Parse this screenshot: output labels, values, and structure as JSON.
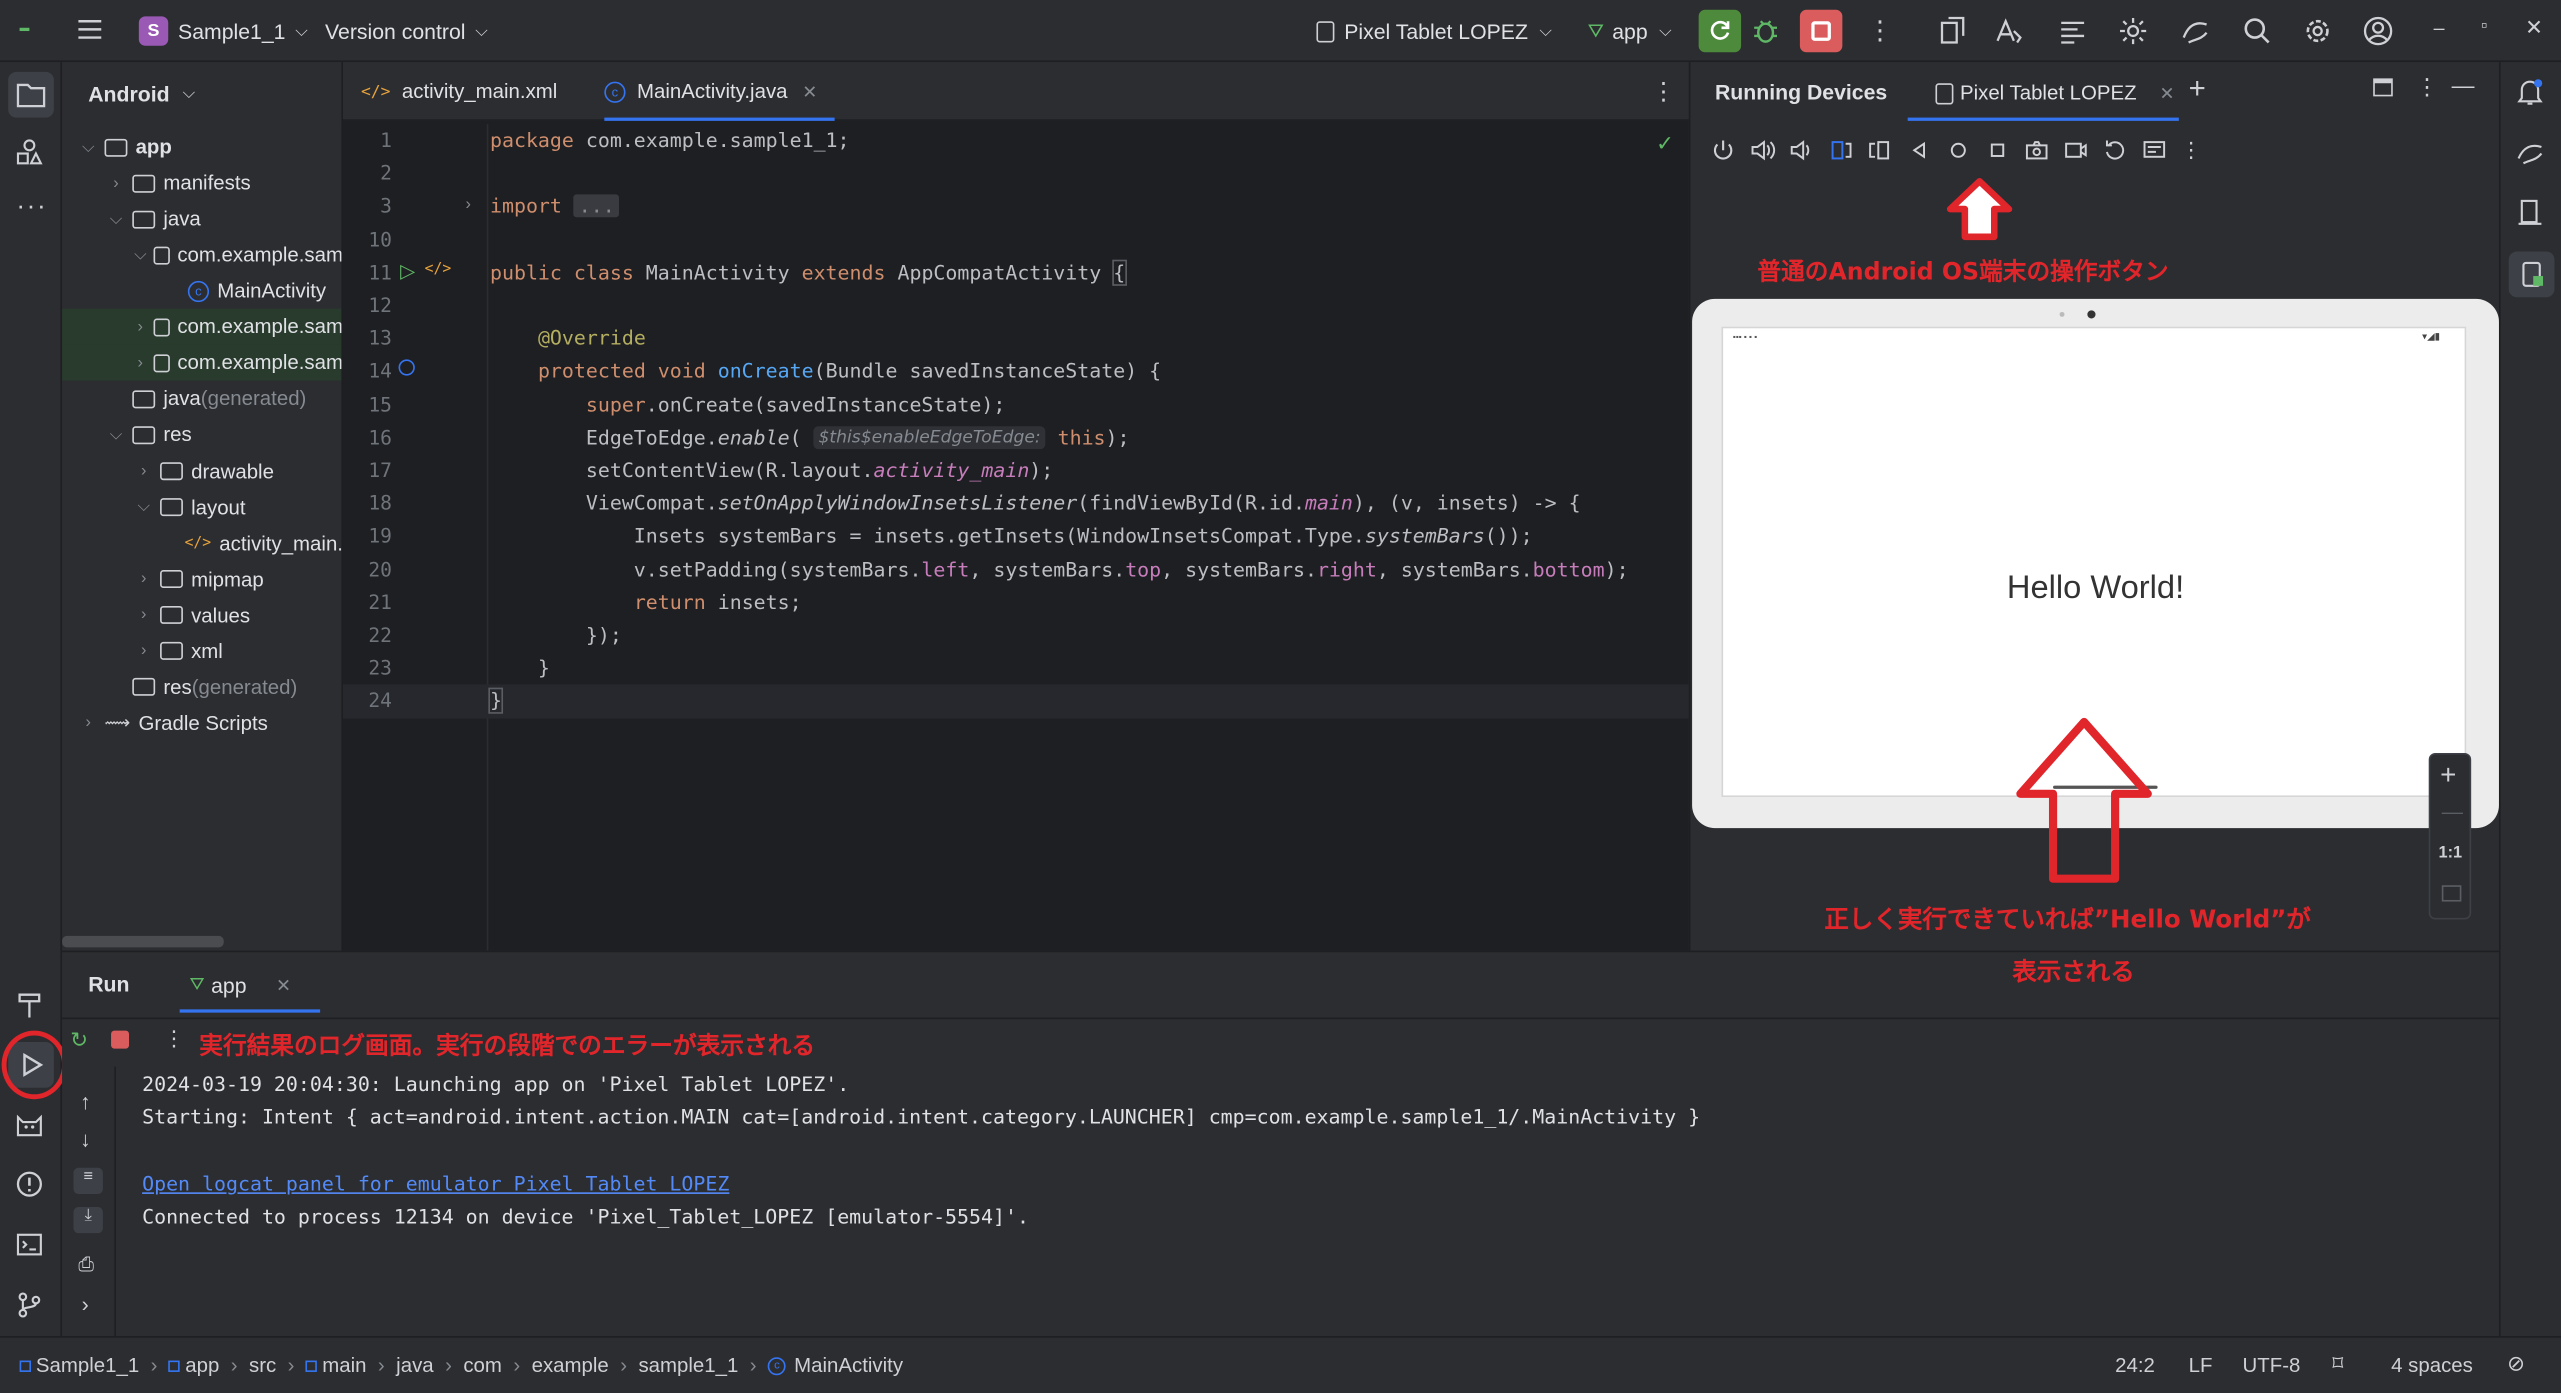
{
  "topbar": {
    "project_badge": "S",
    "project_name": "Sample1_1",
    "vcs": "Version control",
    "device": "Pixel Tablet LOPEZ",
    "run_config": "app"
  },
  "project_panel": {
    "view": "Android",
    "tree": [
      {
        "label": "app",
        "indent": 0,
        "chev": "down",
        "icon": "module",
        "bold": true
      },
      {
        "label": "manifests",
        "indent": 1,
        "chev": "right",
        "icon": "folder"
      },
      {
        "label": "java",
        "indent": 1,
        "chev": "down",
        "icon": "folder"
      },
      {
        "label": "com.example.sam",
        "indent": 2,
        "chev": "down",
        "icon": "package"
      },
      {
        "label": "MainActivity",
        "indent": 3,
        "chev": "",
        "icon": "class"
      },
      {
        "label": "com.example.sam",
        "indent": 2,
        "chev": "right",
        "icon": "package",
        "hl": "green"
      },
      {
        "label": "com.example.sam",
        "indent": 2,
        "chev": "right",
        "icon": "package",
        "hl": "green"
      },
      {
        "label": "java",
        "suffix": " (generated)",
        "indent": 1,
        "chev": "",
        "icon": "folder"
      },
      {
        "label": "res",
        "indent": 1,
        "chev": "down",
        "icon": "folder"
      },
      {
        "label": "drawable",
        "indent": 2,
        "chev": "right",
        "icon": "folder"
      },
      {
        "label": "layout",
        "indent": 2,
        "chev": "down",
        "icon": "folder"
      },
      {
        "label": "activity_main.",
        "indent": 3,
        "chev": "",
        "icon": "xml"
      },
      {
        "label": "mipmap",
        "indent": 2,
        "chev": "right",
        "icon": "folder"
      },
      {
        "label": "values",
        "indent": 2,
        "chev": "right",
        "icon": "folder"
      },
      {
        "label": "xml",
        "indent": 2,
        "chev": "right",
        "icon": "folder"
      },
      {
        "label": "res",
        "suffix": " (generated)",
        "indent": 1,
        "chev": "",
        "icon": "folder"
      },
      {
        "label": "Gradle Scripts",
        "indent": 0,
        "chev": "right",
        "icon": "gradle"
      }
    ]
  },
  "editor": {
    "tabs": [
      {
        "label": "activity_main.xml",
        "icon": "xml",
        "active": false
      },
      {
        "label": "MainActivity.java",
        "icon": "class",
        "active": true
      }
    ],
    "lines": [
      {
        "n": "1",
        "t": [
          [
            "kw",
            "package "
          ],
          [
            "st",
            "com.example.sample1_1;"
          ]
        ]
      },
      {
        "n": "2",
        "t": []
      },
      {
        "n": "3",
        "t": [
          [
            "kw",
            "import "
          ],
          [
            "fold",
            "..."
          ]
        ]
      },
      {
        "n": "10",
        "t": []
      },
      {
        "n": "11",
        "t": [
          [
            "kw",
            "public class "
          ],
          [
            "st",
            "MainActivity "
          ],
          [
            "kw",
            "extends "
          ],
          [
            "st",
            "AppCompatActivity "
          ],
          [
            "br",
            "{"
          ]
        ]
      },
      {
        "n": "12",
        "t": []
      },
      {
        "n": "13",
        "t": [
          [
            "st",
            "    "
          ],
          [
            "an",
            "@Override"
          ]
        ]
      },
      {
        "n": "14",
        "t": [
          [
            "st",
            "    "
          ],
          [
            "kw",
            "protected void "
          ],
          [
            "fn",
            "onCreate"
          ],
          [
            "st",
            "(Bundle savedInstanceState) {"
          ]
        ]
      },
      {
        "n": "15",
        "t": [
          [
            "st",
            "        "
          ],
          [
            "kw",
            "super"
          ],
          [
            "st",
            ".onCreate(savedInstanceState);"
          ]
        ]
      },
      {
        "n": "16",
        "t": [
          [
            "st",
            "        EdgeToEdge."
          ],
          [
            "it",
            "enable"
          ],
          [
            "st",
            "( "
          ],
          [
            "hint",
            "$this$enableEdgeToEdge:"
          ],
          [
            "kw",
            " this"
          ],
          [
            "st",
            ");"
          ]
        ]
      },
      {
        "n": "17",
        "t": [
          [
            "st",
            "        setContentView(R.layout."
          ],
          [
            "pui",
            "activity_main"
          ],
          [
            "st",
            ");"
          ]
        ]
      },
      {
        "n": "18",
        "t": [
          [
            "st",
            "        ViewCompat."
          ],
          [
            "it",
            "setOnApplyWindowInsetsListener"
          ],
          [
            "st",
            "(findViewById(R.id."
          ],
          [
            "pui",
            "main"
          ],
          [
            "st",
            "), (v, insets) -> {"
          ]
        ]
      },
      {
        "n": "19",
        "t": [
          [
            "st",
            "            Insets systemBars = insets.getInsets(WindowInsetsCompat.Type."
          ],
          [
            "it",
            "systemBars"
          ],
          [
            "st",
            "());"
          ]
        ]
      },
      {
        "n": "20",
        "t": [
          [
            "st",
            "            v.setPadding(systemBars."
          ],
          [
            "pu",
            "left"
          ],
          [
            "st",
            ", systemBars."
          ],
          [
            "pu",
            "top"
          ],
          [
            "st",
            ", systemBars."
          ],
          [
            "pu",
            "right"
          ],
          [
            "st",
            ", systemBars."
          ],
          [
            "pu",
            "bottom"
          ],
          [
            "st",
            ");"
          ]
        ]
      },
      {
        "n": "21",
        "t": [
          [
            "st",
            "            "
          ],
          [
            "kw",
            "return "
          ],
          [
            "st",
            "insets;"
          ]
        ]
      },
      {
        "n": "22",
        "t": [
          [
            "st",
            "        });"
          ]
        ]
      },
      {
        "n": "23",
        "t": [
          [
            "st",
            "    }"
          ]
        ]
      },
      {
        "n": "24",
        "t": [
          [
            "br",
            "}"
          ]
        ]
      }
    ]
  },
  "devices": {
    "title": "Running Devices",
    "tab": "Pixel Tablet LOPEZ",
    "screen_text": "Hello World!",
    "zoom_label": "1:1",
    "annotation_buttons": "普通のAndroid OS端末の操作ボタン",
    "annotation_hello_1": "正しく実行できていれば”Hello World”が",
    "annotation_hello_2": "表示される"
  },
  "run": {
    "title": "Run",
    "tab": "app",
    "annotation": "実行結果のログ画面。実行の段階でのエラーが表示される",
    "log": [
      "2024-03-19 20:04:30: Launching app on 'Pixel Tablet LOPEZ'.",
      "Starting: Intent { act=android.intent.action.MAIN cat=[android.intent.category.LAUNCHER] cmp=com.example.sample1_1/.MainActivity }",
      "",
      "Open logcat panel for emulator Pixel Tablet LOPEZ",
      "Connected to process 12134 on device 'Pixel_Tablet_LOPEZ [emulator-5554]'."
    ]
  },
  "statusbar": {
    "breadcrumb": [
      "Sample1_1",
      "app",
      "src",
      "main",
      "java",
      "com",
      "example",
      "sample1_1",
      "MainActivity"
    ],
    "position": "24:2",
    "line_sep": "LF",
    "encoding": "UTF-8",
    "indent": "4 spaces"
  },
  "colors": {
    "accent": "#3574f0",
    "run_green": "#4e8a3c",
    "stop_red": "#db5c5c",
    "annotation": "#e0252b"
  }
}
